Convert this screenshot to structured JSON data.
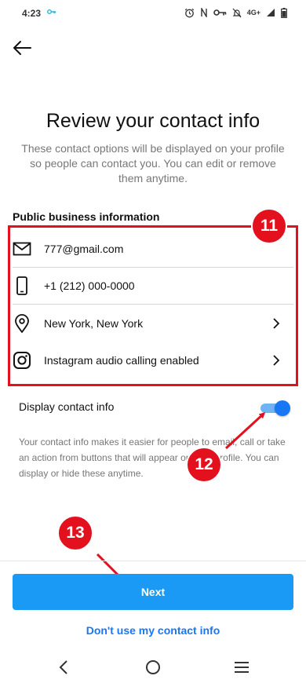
{
  "status_bar": {
    "time": "4:23",
    "network": "4G+"
  },
  "page": {
    "title": "Review your contact info",
    "subtitle": "These contact options will be displayed on your profile so people can contact you. You can edit or remove them anytime."
  },
  "section": {
    "label": "Public business information"
  },
  "contact_items": [
    {
      "icon": "email-icon",
      "text": "777@gmail.com",
      "chevron": false
    },
    {
      "icon": "phone-icon",
      "text": "+1 (212) 000-0000",
      "chevron": false
    },
    {
      "icon": "location-pin-icon",
      "text": "New York, New York",
      "chevron": true
    },
    {
      "icon": "instagram-icon",
      "text": "Instagram audio calling enabled",
      "chevron": true
    }
  ],
  "display_toggle": {
    "label": "Display contact info",
    "on": true
  },
  "explanation": "Your contact info makes it easier for people to email, call or take an action from buttons that will appear on your profile. You can display or hide these anytime.",
  "actions": {
    "next_label": "Next",
    "skip_label": "Don't use my contact info"
  },
  "annotations": {
    "badge_11": "11",
    "badge_12": "12",
    "badge_13": "13"
  },
  "colors": {
    "annotation_red": "#e3101e",
    "primary_blue": "#1a9af5",
    "link_blue": "#1877f2"
  }
}
